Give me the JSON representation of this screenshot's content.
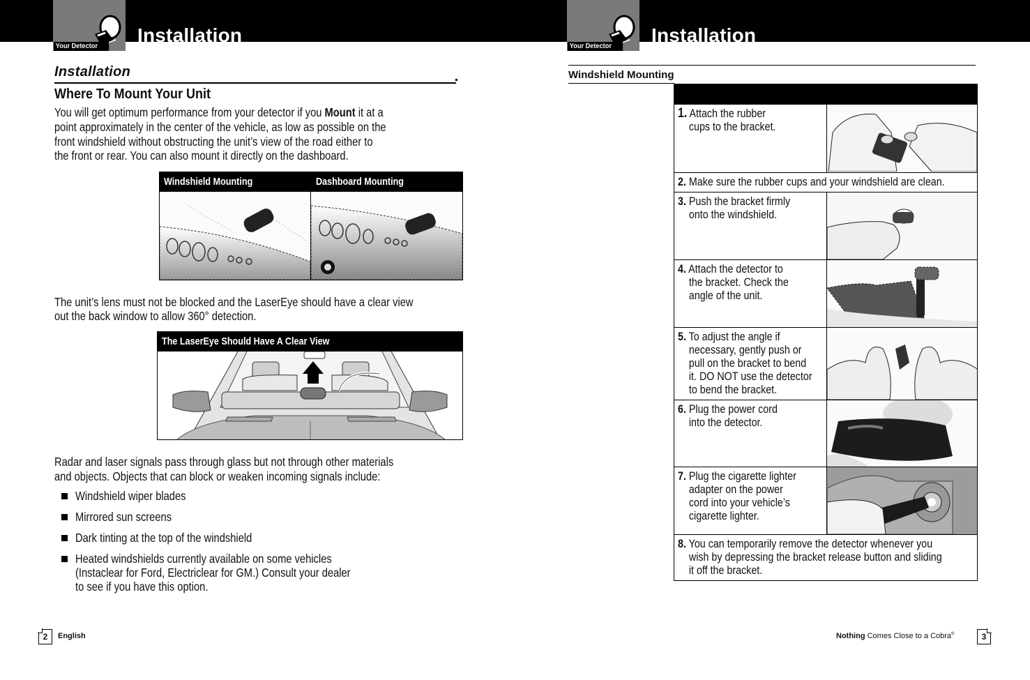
{
  "left_page": {
    "header": {
      "tab_label": "Your Detector",
      "title": "Installation",
      "icon": "detector-icon"
    },
    "section_title": "Installation",
    "subsection_title": "Where To Mount Your Unit",
    "intro_paragraph": {
      "lines": [
        [
          "You will get optimum performance from your detector if you ",
          "Mount",
          " it at a"
        ],
        "point approximately in the center of the vehicle, as low as possible on the",
        "front windshield without obstructing the unit’s view of the road either to",
        "the front or rear. You can also mount it directly on the dashboard."
      ],
      "line0_pre": "You will get optimum performance from your detector if you ",
      "line0_bold": "Mount",
      "line0_post": " it at a",
      "line1": "point approximately in the center of the vehicle, as low as possible on the",
      "line2": "front windshield without obstructing the unit’s view of the road either to",
      "line3": "the front or rear. You can also mount it directly on the dashboard."
    },
    "mounting_figure": {
      "left_caption": "Windshield Mounting",
      "right_caption": "Dashboard Mounting"
    },
    "lens_paragraph": {
      "line0": "The unit’s lens must not be blocked and the LaserEye should have a clear view",
      "line1": "out the back window to allow 360° detection."
    },
    "lasereye_figure": {
      "caption": "The LaserEye Should Have A Clear View"
    },
    "signals_paragraph": {
      "line0": "Radar and laser signals pass through glass but not through other materials",
      "line1": "and objects. Objects that can block or weaken incoming signals include:"
    },
    "bullets": [
      {
        "lines": [
          "Windshield wiper blades"
        ]
      },
      {
        "lines": [
          "Mirrored sun screens"
        ]
      },
      {
        "lines": [
          "Dark tinting at the top of the windshield"
        ]
      },
      {
        "lines": [
          "Heated windshields currently available on some vehicles",
          "(Instaclear for Ford, Electriclear for GM.) Consult your dealer",
          "to see if you have this option."
        ]
      }
    ],
    "footer": {
      "page_number": "2",
      "language": "English"
    }
  },
  "right_page": {
    "header": {
      "tab_label": "Your Detector",
      "title": "Installation",
      "icon": "detector-icon"
    },
    "section_title": "Windshield Mounting",
    "steps": [
      {
        "num": "1.",
        "lines": [
          "Attach the rubber",
          "cups to the bracket."
        ],
        "image": "hands-attaching-cups"
      },
      {
        "num": "2.",
        "lines": [
          "Make sure the rubber cups and your windshield are clean."
        ],
        "image": null
      },
      {
        "num": "3.",
        "lines": [
          "Push the bracket firmly",
          "onto the windshield."
        ],
        "image": "finger-pushing-bracket"
      },
      {
        "num": "4.",
        "lines": [
          "Attach the detector to",
          "the bracket. Check the",
          "angle of the unit."
        ],
        "image": "detector-on-bracket"
      },
      {
        "num": "5.",
        "lines": [
          "To adjust the angle if",
          "necessary, gently push or",
          "pull on the bracket to bend",
          "it. DO NOT use the detector",
          "to bend the bracket."
        ],
        "image": "hands-bending-bracket"
      },
      {
        "num": "6.",
        "lines": [
          "Plug the power cord",
          "into the detector."
        ],
        "image": "power-cord-plug"
      },
      {
        "num": "7.",
        "lines": [
          "Plug the cigarette lighter",
          "adapter on the power",
          "cord into your vehicle’s",
          "cigarette lighter."
        ],
        "image": "cigarette-lighter-adapter"
      },
      {
        "num": "8.",
        "lines": [
          "You can temporarily remove the detector whenever you",
          "wish by depressing the bracket release button and sliding",
          "it off the bracket."
        ],
        "image": null
      }
    ],
    "footer": {
      "tagline_bold": "Nothing",
      "tagline_rest": " Comes Close to a Cobra",
      "registered": "®",
      "page_number": "3"
    }
  }
}
